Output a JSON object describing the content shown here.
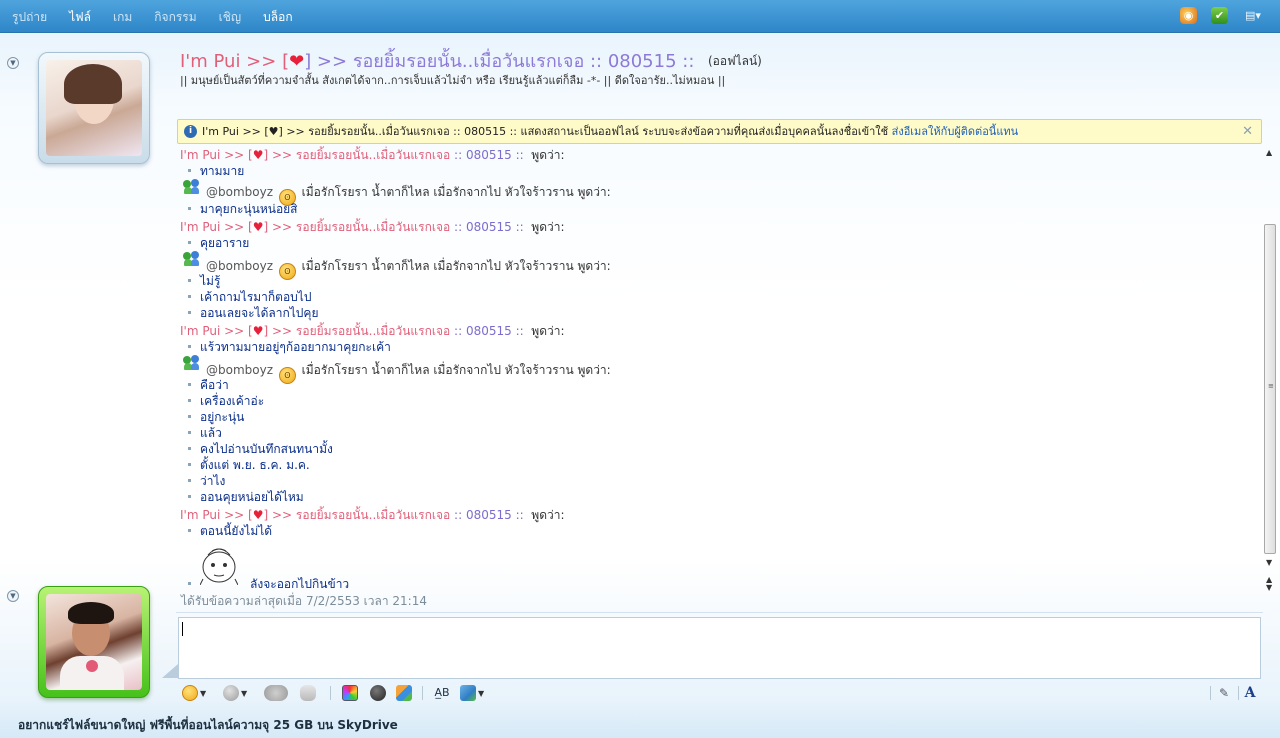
{
  "menu": {
    "items": [
      {
        "label": "รูปถ่าย",
        "active": false
      },
      {
        "label": "ไฟล์",
        "active": true
      },
      {
        "label": "เกม",
        "active": false
      },
      {
        "label": "กิจกรรม",
        "active": false
      },
      {
        "label": "เชิญ",
        "active": true
      },
      {
        "label": "บล็อก",
        "active": true
      }
    ],
    "right_icons": [
      "palette-icon",
      "shield-icon",
      "menu-dropdown-icon"
    ]
  },
  "contact": {
    "name_part1": "I'm Pui >> [",
    "heart": "❤",
    "name_part2": "] >> รอยยิ้มรอยนั้น..เมื่อวันแรกเจอ :: 080515 ::",
    "status": "(ออฟไลน์)",
    "personal_message": "|| มนุษย์เป็นสัตว์ที่ความจำสั้น สังเกตได้จาก..การเจ็บแล้วไม่จำ หรือ เรียนรู้แล้วแต่ก็ลืม -*- || ดีดใจอารัย..ไม่หมอน ||"
  },
  "infobar": {
    "text": "I'm Pui >> [♥] >> รอยยิ้มรอยนั้น..เมื่อวันแรกเจอ :: 080515 ::  แสดงสถานะเป็นออฟไลน์ ระบบจะส่งข้อความที่คุณส่งเมื่อบุคคลนั้นลงชื่อเข้าใช้",
    "link": "ส่งอีเมลให้กับผู้ติดต่อนี้แทน",
    "close": "✕"
  },
  "conversation": {
    "me": {
      "part1": "I'm Pui >> [",
      "heart": "♥",
      "part2": "] >> รอยยิ้มรอยนั้น..เมื่อวันแรกเจอ",
      "part3": ":: 080515 ::",
      "says": "พูดว่า:"
    },
    "buddy": {
      "name": "@bomboyz",
      "tagline": "เมื่อรักโรยรา น้ำตาก็ไหล เมื่อรักจากไป หัวใจร้าวราน",
      "says": "พูดว่า:"
    },
    "blocks": [
      {
        "from": "me",
        "messages": [
          "ทามมาย"
        ]
      },
      {
        "from": "buddy",
        "messages": [
          "มาคุยกะนุ่นหน่อยสิ"
        ]
      },
      {
        "from": "me",
        "messages": [
          "คุยอาราย"
        ]
      },
      {
        "from": "buddy",
        "messages": [
          "ไม่รู้",
          "เค้าถามไรมาก็ตอบไป",
          "ออนเลยจะได้ลากไปคุย"
        ]
      },
      {
        "from": "me",
        "messages": [
          "แร้วทามมายอยู่ๆก้ออยากมาคุยกะเค้า"
        ]
      },
      {
        "from": "buddy",
        "messages": [
          "คือว่า",
          "เครื่องเค้าอ่ะ",
          "อยู่กะนุ่น",
          "แล้ว",
          "คงไปอ่านบันทึกสนทนามั้ง",
          "ตั้งแต่ พ.ย.  ธ.ค.  ม.ค.",
          "ว่าไง",
          "ออนคุยหน่อยได้ไหม"
        ]
      },
      {
        "from": "me",
        "messages": [
          "ตอนนี้ยังไม่ได้",
          "ลังจะออกไปกินข้าว"
        ]
      }
    ],
    "last_received": "ได้รับข้อความล่าสุดเมื่อ 7/2/2553 เวลา 21:14"
  },
  "compose": {
    "value": ""
  },
  "toolbar": {
    "left": [
      "emoticon-icon",
      "wink-icon",
      "nudge-icon",
      "voice-clip-icon"
    ],
    "middle": [
      "background-icon",
      "games-icon",
      "activities-icon"
    ],
    "right_group": [
      "font-icon",
      "image-share-icon"
    ],
    "far_right": [
      "handwriting-icon",
      "font-style-icon"
    ]
  },
  "ad": {
    "text": "อยากแชร์ไฟล์ขนาดใหญ่ ฟรีพื้นที่ออนไลน์ความจุ 25 GB บน SkyDrive"
  },
  "colors": {
    "topbar": "#3f95d4",
    "my_name": "#e0607a",
    "my_name_alt": "#7d6cd0",
    "message_text": "#0c2f8a",
    "infobar_bg": "#fffbc8",
    "online_frame": "#46c11a"
  }
}
